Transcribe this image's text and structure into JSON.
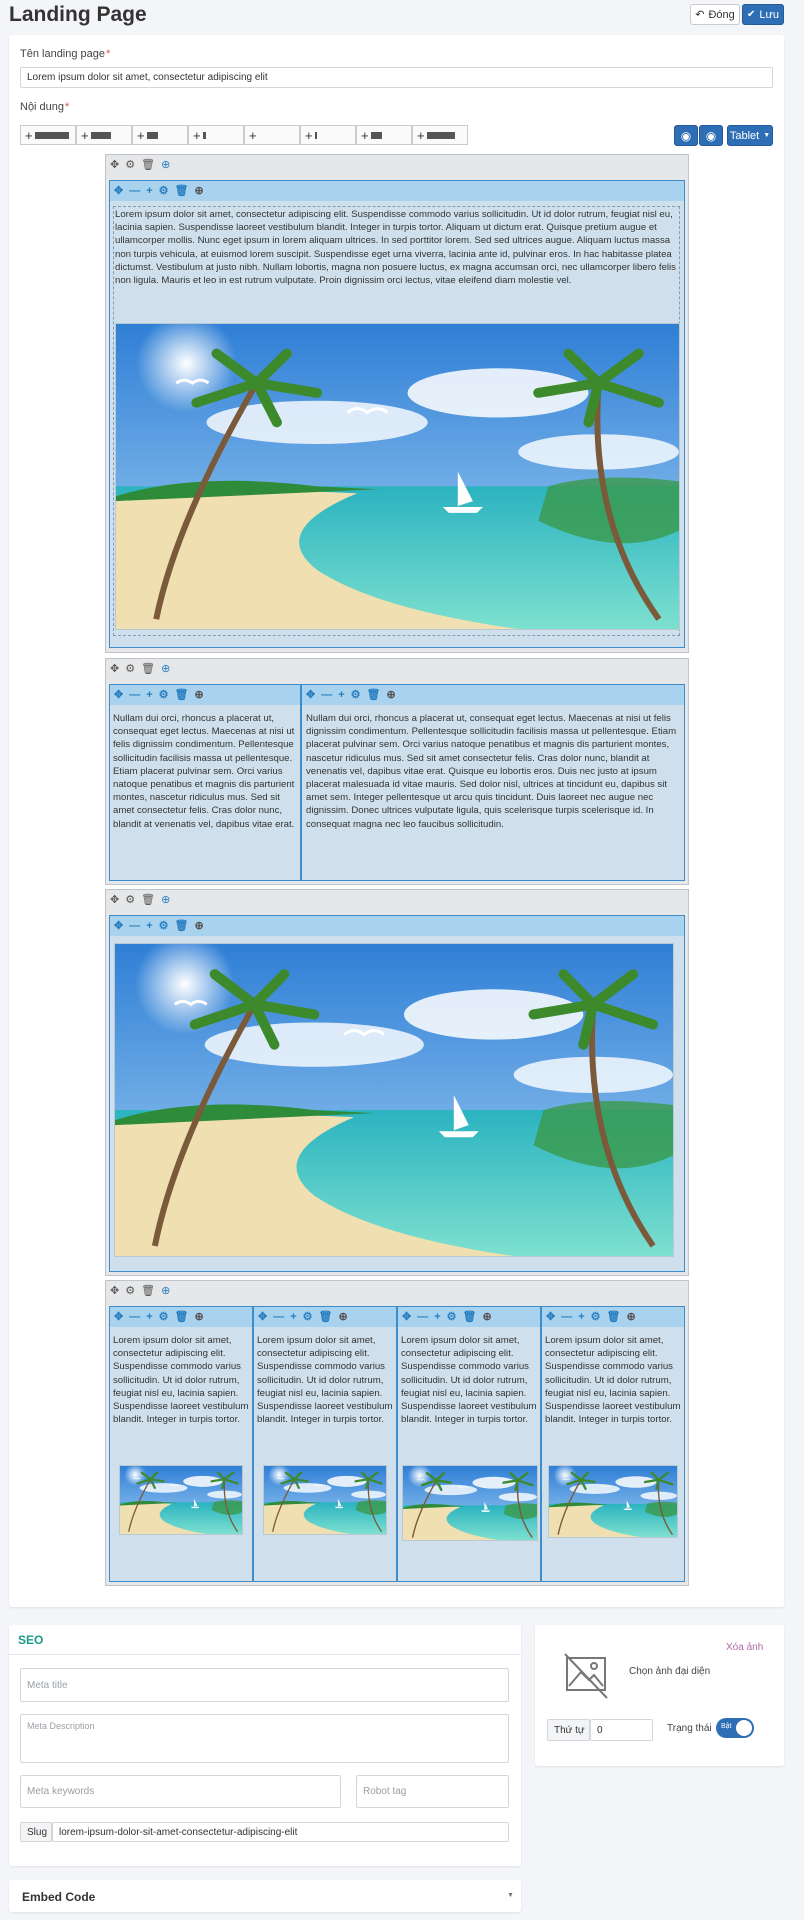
{
  "page": {
    "title": "Landing Page",
    "close_label": "Đóng",
    "save_label": "Lưu"
  },
  "form": {
    "name_label": "Tên landing page",
    "name_value": "Lorem ipsum dolor sit amet, consectetur adipiscing elit",
    "content_label": "Nội dung",
    "required_mark": "*",
    "device_label": "Tablet"
  },
  "builder": {
    "row1_text": "Lorem ipsum dolor sit amet, consectetur adipiscing elit. Suspendisse commodo varius sollicitudin. Ut id dolor rutrum, feugiat nisl eu, lacinia sapien. Suspendisse laoreet vestibulum blandit. Integer in turpis tortor. Aliquam ut dictum erat. Quisque pretium augue et ullamcorper mollis. Nunc eget ipsum in lorem aliquam ultrices. In sed porttitor lorem. Sed sed ultrices augue. Aliquam luctus massa non turpis vehicula, at euismod lorem suscipit. Suspendisse eget urna viverra, lacinia ante id, pulvinar eros. In hac habitasse platea dictumst. Vestibulum at justo nibh. Nullam lobortis, magna non posuere luctus, ex magna accumsan orci, nec ullamcorper libero felis non ligula. Mauris et leo in est rutrum vulputate. Proin dignissim orci lectus, vitae eleifend diam molestie vel.",
    "row2_left": "Nullam dui orci, rhoncus a placerat ut, consequat eget lectus. Maecenas at nisi ut felis dignissim condimentum. Pellentesque sollicitudin facilisis massa ut pellentesque. Etiam placerat pulvinar sem. Orci varius natoque penatibus et magnis dis parturient montes, nascetur ridiculus mus. Sed sit amet consectetur felis. Cras dolor nunc, blandit at venenatis vel, dapibus vitae erat.",
    "row2_right": "Nullam dui orci, rhoncus a placerat ut, consequat eget lectus. Maecenas at nisi ut felis dignissim condimentum. Pellentesque sollicitudin facilisis massa ut pellentesque. Etiam placerat pulvinar sem. Orci varius natoque penatibus et magnis dis parturient montes, nascetur ridiculus mus. Sed sit amet consectetur felis. Cras dolor nunc, blandit at venenatis vel, dapibus vitae erat. Quisque eu lobortis eros. Duis nec justo at ipsum placerat malesuada id vitae mauris. Sed dolor nisl, ultrices at tincidunt eu, dapibus sit amet sem. Integer pellentesque ut arcu quis tincidunt. Duis laoreet nec augue nec dignissim. Donec ultrices vulputate ligula, quis scelerisque turpis scelerisque id. In consequat magna nec leo faucibus sollicitudin.",
    "row4_text": "Lorem ipsum dolor sit amet, consectetur adipiscing elit. Suspendisse commodo varius sollicitudin. Ut id dolor rutrum, feugiat nisl eu, lacinia sapien. Suspendisse laoreet vestibulum blandit. Integer in turpis tortor."
  },
  "seo": {
    "heading": "SEO",
    "meta_title": "Meta title",
    "meta_description": "Meta Description",
    "meta_keywords": "Meta keywords",
    "robot_tag": "Robot tag",
    "slug_label": "Slug",
    "slug_value": "lorem-ipsum-dolor-sit-amet-consectetur-adipiscing-elit"
  },
  "side": {
    "remove_image": "Xóa ảnh",
    "choose_image": "Chọn ảnh đại diện",
    "order_label": "Thứ tự",
    "order_value": "0",
    "status_label": "Trạng thái",
    "toggle_label": "Bật"
  },
  "embed": {
    "heading": "Embed Code"
  },
  "colors": {
    "primary": "#2d6eb4",
    "seo_heading": "#1a9b8a",
    "remove_link": "#b06aa8",
    "column_bg": "#cfe0ec",
    "column_bar": "#a9d2ee"
  }
}
